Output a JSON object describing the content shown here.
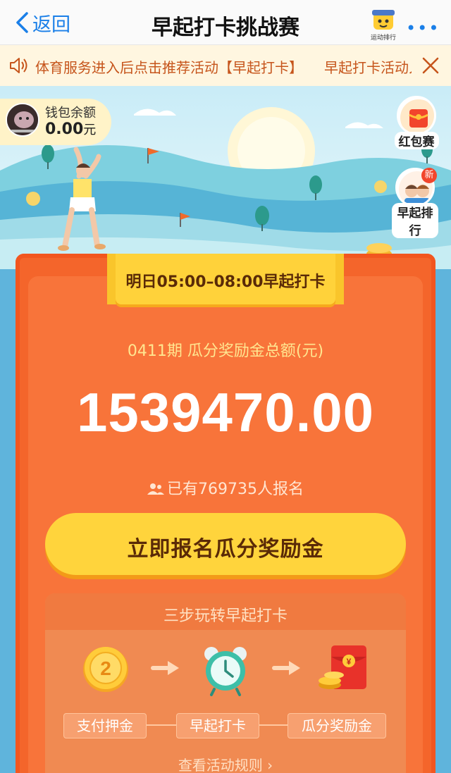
{
  "nav": {
    "back_label": "返回",
    "title": "早起打卡挑战赛",
    "mini_app_caption": "运动排行"
  },
  "notice": {
    "text": "体育服务进入后点击推荐活动【早起打卡】　　早起打卡活动入口"
  },
  "wallet": {
    "label": "钱包余额",
    "value": "0.00",
    "unit": "元"
  },
  "side": {
    "red_packet_label": "红包赛",
    "rank_label": "早起排行",
    "new_badge": "新"
  },
  "card": {
    "time_tag": "明日05:00–08:00早起打卡",
    "period_label": "0411期  瓜分奖励金总额(元)",
    "amount": "1539470.00",
    "joined_text": "已有769735人报名",
    "cta_label": "立即报名瓜分奖励金"
  },
  "steps": {
    "title": "三步玩转早起打卡",
    "coin_number": "2",
    "items": [
      {
        "label": "支付押金",
        "icon": "coin-icon"
      },
      {
        "label": "早起打卡",
        "icon": "alarm-clock-icon"
      },
      {
        "label": "瓜分奖励金",
        "icon": "red-envelope-icon"
      }
    ],
    "rules_link": "查看活动规则 ›"
  },
  "colors": {
    "accent_blue": "#1a7fe8",
    "card_orange": "#f4652b",
    "cta_yellow": "#ffd43c",
    "notice_text": "#c6551c"
  }
}
